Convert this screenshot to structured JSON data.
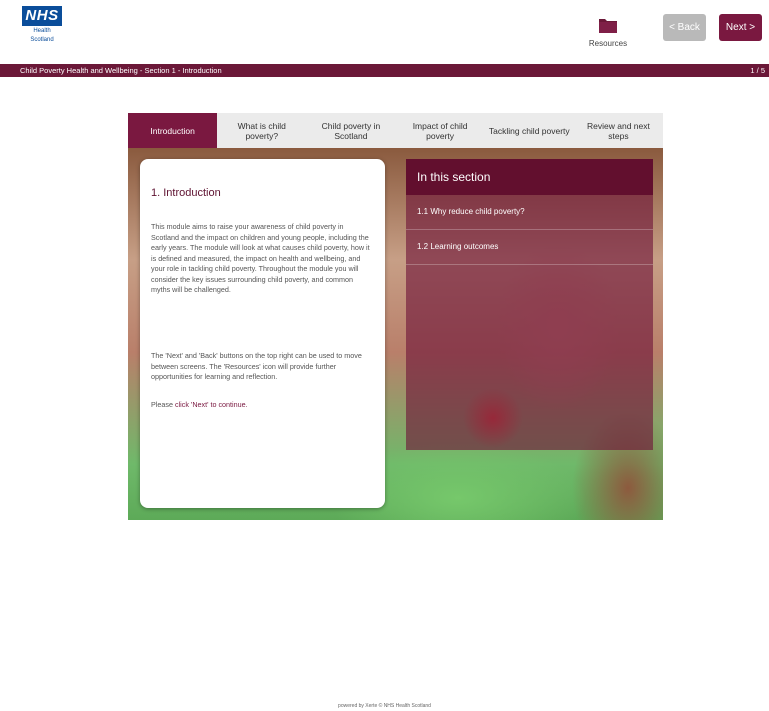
{
  "header": {
    "logo_text": "NHS",
    "logo_sub_line1": "Health",
    "logo_sub_line2": "Scotland",
    "resources_label": "Resources",
    "back_label": "< Back",
    "next_label": "Next >"
  },
  "breadcrumb": {
    "path": "Child Poverty Health and Wellbeing - Section 1 - Introduction",
    "page": "1 / 5"
  },
  "tabs": [
    {
      "label": "Introduction",
      "active": true
    },
    {
      "label": "What is child poverty?",
      "active": false
    },
    {
      "label": "Child poverty in Scotland",
      "active": false
    },
    {
      "label": "Impact of child poverty",
      "active": false
    },
    {
      "label": "Tackling child poverty",
      "active": false
    },
    {
      "label": "Review and next steps",
      "active": false
    }
  ],
  "content": {
    "title": "1. Introduction",
    "paragraph1": "This module aims to raise your awareness of child poverty in Scotland and the impact on children and young people, including the early years. The module will look at what causes child poverty, how it is defined and measured, the impact on health and wellbeing, and your role in tackling child poverty. Throughout the module you will consider the key issues surrounding child poverty, and common myths will be challenged.",
    "paragraph2": "The 'Next' and 'Back' buttons on the top right can be used to move between screens. The 'Resources' icon will provide further opportunities for learning and reflection.",
    "paragraph3_prefix": "Please ",
    "paragraph3_link": "click 'Next' to continue."
  },
  "section_panel": {
    "heading": "In this section",
    "items": [
      "1.1 Why reduce child poverty?",
      "1.2 Learning outcomes"
    ]
  },
  "footer": {
    "text": "powered by Xerte   © NHS Health Scotland"
  },
  "colors": {
    "brand": "#7a1840",
    "breadcrumb_bar": "#6b1838",
    "nhs_blue": "#0a4d9a",
    "back_button": "#b9b9b9"
  }
}
